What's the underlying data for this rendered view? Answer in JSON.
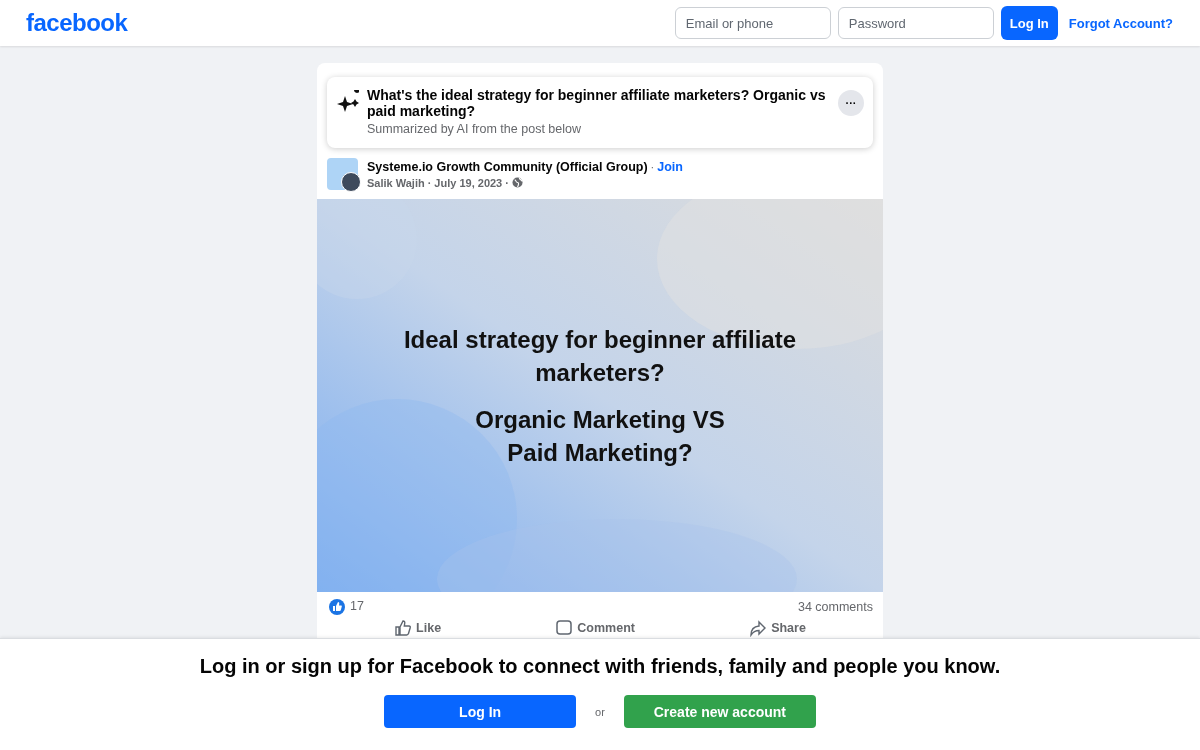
{
  "header": {
    "logo": "facebook",
    "email": {
      "placeholder": "Email or phone"
    },
    "password": {
      "placeholder": "Password"
    },
    "login": "Log In",
    "forgot": "Forgot Account?"
  },
  "summary": {
    "question": "What's the ideal strategy for beginner affiliate marketers? Organic vs paid marketing?",
    "note": "Summarized by AI from the post below",
    "more": "···"
  },
  "post": {
    "group": "Systeme.io Growth Community (Official Group)",
    "separator": "·",
    "join": "Join",
    "author": "Salik Wajih",
    "date": "July 19, 2023",
    "image_text": [
      "Ideal strategy for beginner affiliate marketers?",
      "Organic Marketing VS Paid Marketing?"
    ],
    "likes": "17",
    "comments": "34 comments",
    "actions": [
      {
        "kind": "like",
        "label": "Like"
      },
      {
        "kind": "comment",
        "label": "Comment"
      },
      {
        "kind": "share",
        "label": "Share"
      }
    ]
  },
  "banner": {
    "text": "Log in or sign up for Facebook to connect with friends, family and people you know.",
    "login": "Log In",
    "or": "or",
    "create": "Create new account"
  }
}
